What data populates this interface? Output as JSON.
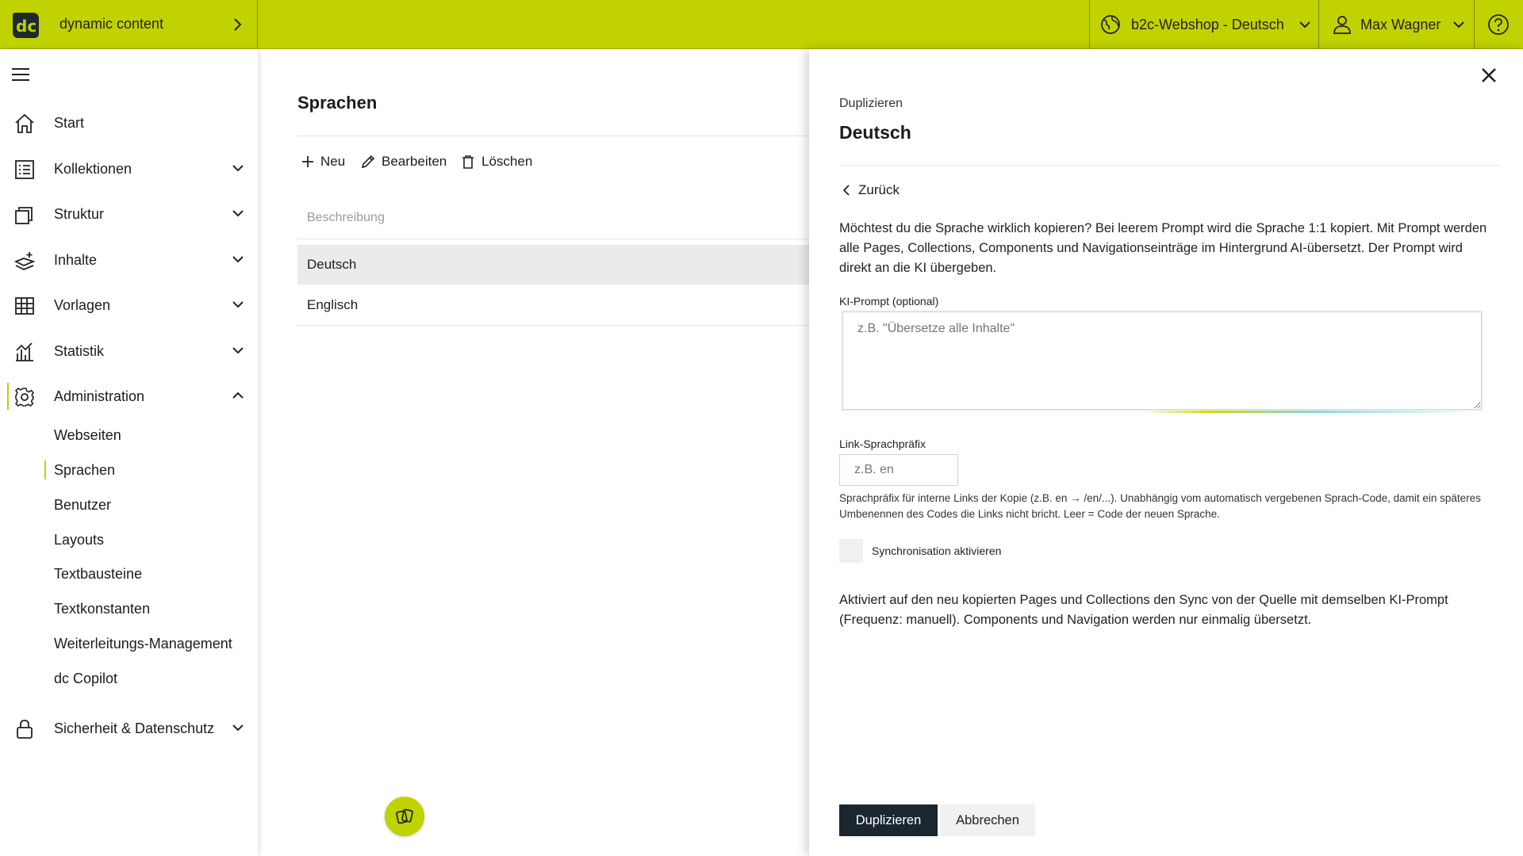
{
  "topbar": {
    "app_name": "dynamic content",
    "site_selector": "b2c-Webshop - Deutsch",
    "user_name": "Max Wagner"
  },
  "sidebar": {
    "items": [
      {
        "label": "Start",
        "icon": "home-icon"
      },
      {
        "label": "Kollektionen",
        "icon": "list-icon"
      },
      {
        "label": "Struktur",
        "icon": "layers-icon"
      },
      {
        "label": "Inhalte",
        "icon": "content-icon"
      },
      {
        "label": "Vorlagen",
        "icon": "grid-icon"
      },
      {
        "label": "Statistik",
        "icon": "chart-icon"
      },
      {
        "label": "Administration",
        "icon": "gear-icon"
      },
      {
        "label": "Sicherheit & Datenschutz",
        "icon": "lock-icon"
      }
    ],
    "admin_subitems": [
      "Webseiten",
      "Sprachen",
      "Benutzer",
      "Layouts",
      "Textbausteine",
      "Textkonstanten",
      "Weiterleitungs-Management",
      "dc Copilot"
    ]
  },
  "main": {
    "title": "Sprachen",
    "toolbar": {
      "new_label": "Neu",
      "edit_label": "Bearbeiten",
      "delete_label": "Löschen"
    },
    "list_header": "Beschreibung",
    "rows": [
      "Deutsch",
      "Englisch"
    ]
  },
  "drawer": {
    "subtitle": "Duplizieren",
    "title": "Deutsch",
    "back_label": "Zurück",
    "description": "Möchtest du die Sprache wirklich kopieren? Bei leerem Prompt wird die Sprache 1:1 kopiert. Mit Prompt werden alle Pages, Collections, Components und Navigationseinträge im Hintergrund AI-übersetzt. Der Prompt wird direkt an die KI übergeben.",
    "prompt_label": "KI-Prompt (optional)",
    "prompt_placeholder": "z.B. \"Übersetze alle Inhalte\"",
    "prefix_label": "Link-Sprachpräfix",
    "prefix_placeholder": "z.B. en",
    "prefix_hint": "Sprachpräfix für interne Links der Kopie (z.B. en → /en/...). Unabhängig vom automatisch vergebenen Sprach-Code, damit ein späteres Umbenennen des Codes die Links nicht bricht. Leer = Code der neuen Sprache.",
    "sync_label": "Synchronisation aktivieren",
    "sync_description": "Aktiviert auf den neu kopierten Pages und Collections den Sync von der Quelle mit demselben KI-Prompt (Frequenz: manuell). Components und Navigation werden nur einmalig übersetzt.",
    "submit_label": "Duplizieren",
    "cancel_label": "Abbrechen"
  },
  "colors": {
    "accent": "#c0d200",
    "primary_button": "#1a2630"
  }
}
